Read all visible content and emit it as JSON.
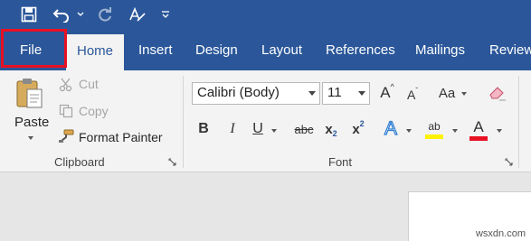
{
  "qat": {
    "icons": [
      "save-icon",
      "undo-icon",
      "redo-icon",
      "format-icon",
      "customize-icon"
    ]
  },
  "tabs": [
    {
      "label": "File",
      "active": false
    },
    {
      "label": "Home",
      "active": true
    },
    {
      "label": "Insert",
      "active": false
    },
    {
      "label": "Design",
      "active": false
    },
    {
      "label": "Layout",
      "active": false
    },
    {
      "label": "References",
      "active": false
    },
    {
      "label": "Mailings",
      "active": false
    },
    {
      "label": "Review",
      "active": false
    }
  ],
  "clipboard": {
    "paste": "Paste",
    "cut": "Cut",
    "copy": "Copy",
    "format_painter": "Format Painter",
    "label": "Clipboard"
  },
  "font": {
    "font_name": "Calibri (Body)",
    "font_size": "11",
    "bold": "B",
    "italic": "I",
    "underline": "U",
    "strikethrough": "abc",
    "subscript": "x",
    "subscript_mark": "2",
    "superscript": "x",
    "superscript_mark": "2",
    "text_effects": "A",
    "highlight": "ab",
    "font_color": "A",
    "change_case": "Aa",
    "grow": "A",
    "shrink": "A",
    "label": "Font"
  },
  "colors": {
    "brand": "#2b579a",
    "highlight": "#fff200",
    "font_color": "#e81123",
    "focus_box": "#e81123"
  },
  "watermark": "wsxdn.com"
}
